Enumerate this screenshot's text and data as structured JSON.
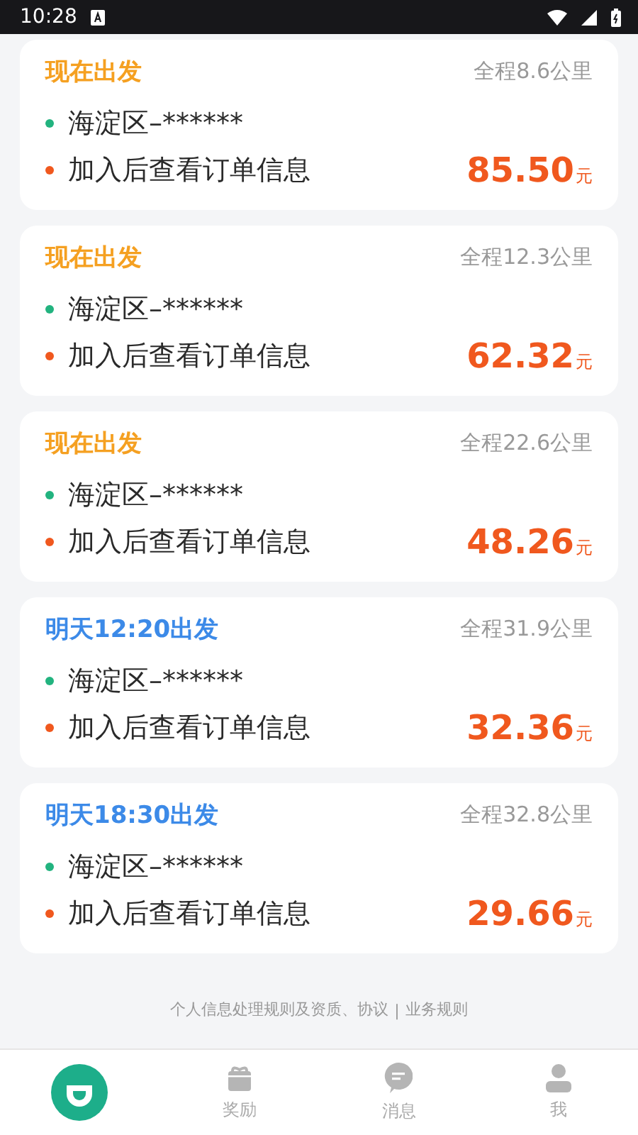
{
  "status_bar": {
    "time": "10:28"
  },
  "orders": [
    {
      "kind": "now",
      "departure": "现在出发",
      "distance": "全程8.6公里",
      "origin": "海淀区–******",
      "destination": "加入后查看订单信息",
      "price": "85.50",
      "unit": "元"
    },
    {
      "kind": "now",
      "departure": "现在出发",
      "distance": "全程12.3公里",
      "origin": "海淀区–******",
      "destination": "加入后查看订单信息",
      "price": "62.32",
      "unit": "元"
    },
    {
      "kind": "now",
      "departure": "现在出发",
      "distance": "全程22.6公里",
      "origin": "海淀区–******",
      "destination": "加入后查看订单信息",
      "price": "48.26",
      "unit": "元"
    },
    {
      "kind": "scheduled",
      "departure": "明天12:20出发",
      "distance": "全程31.9公里",
      "origin": "海淀区–******",
      "destination": "加入后查看订单信息",
      "price": "32.36",
      "unit": "元"
    },
    {
      "kind": "scheduled",
      "departure": "明天18:30出发",
      "distance": "全程32.8公里",
      "origin": "海淀区–******",
      "destination": "加入后查看订单信息",
      "price": "29.66",
      "unit": "元"
    }
  ],
  "footer": {
    "links": [
      "个人信息处理规则及资质、协议",
      "业务规则"
    ],
    "separator": "|"
  },
  "bottom_nav": [
    {
      "kind": "home",
      "selected": true
    },
    {
      "kind": "gift",
      "label": "奖励",
      "selected": false
    },
    {
      "kind": "message",
      "label": "消息",
      "selected": false
    },
    {
      "kind": "profile",
      "label": "我",
      "selected": false
    }
  ]
}
